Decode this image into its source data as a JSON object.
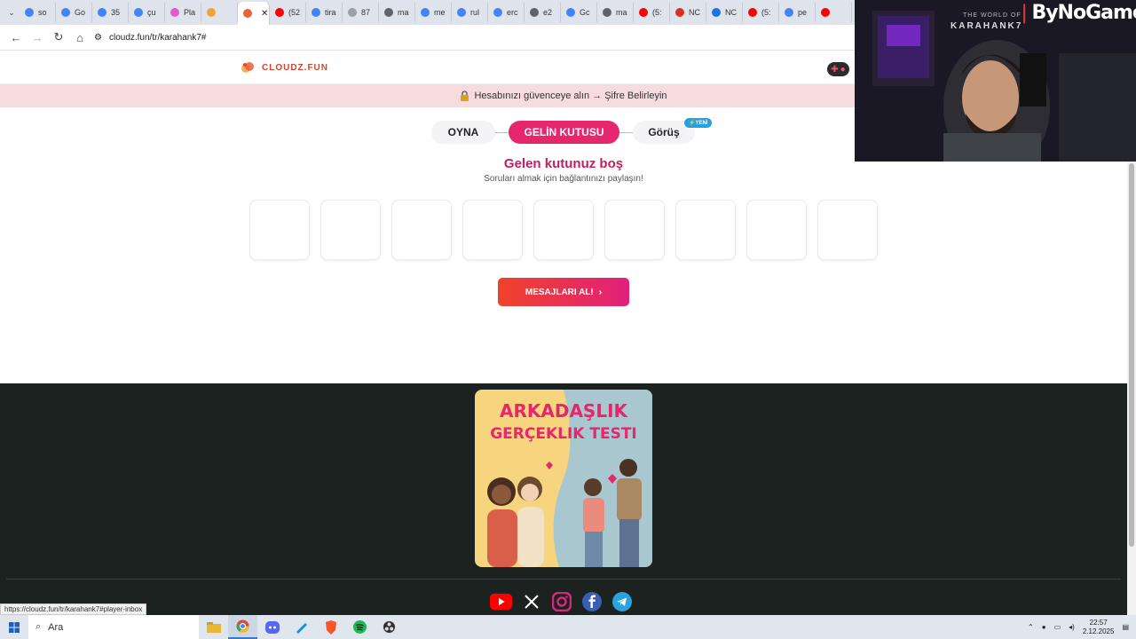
{
  "browser": {
    "tabs": [
      {
        "label": "so",
        "favicon_color": "#4285f4"
      },
      {
        "label": "Go",
        "favicon_color": "#4285f4"
      },
      {
        "label": "35",
        "favicon_color": "#4285f4"
      },
      {
        "label": "çu",
        "favicon_color": "#4285f4"
      },
      {
        "label": "Pla",
        "favicon_color": "#e05cc8"
      },
      {
        "label": "",
        "favicon_color": "#f2a23a"
      },
      {
        "label": "",
        "favicon_color": "#e8623a",
        "active": true
      },
      {
        "label": "(52",
        "favicon_color": "#ff0000"
      },
      {
        "label": "tira",
        "favicon_color": "#4285f4"
      },
      {
        "label": "87",
        "favicon_color": "#9aa0a6"
      },
      {
        "label": "ma",
        "favicon_color": "#5f6368"
      },
      {
        "label": "me",
        "favicon_color": "#4285f4"
      },
      {
        "label": "rul",
        "favicon_color": "#4285f4"
      },
      {
        "label": "erc",
        "favicon_color": "#4285f4"
      },
      {
        "label": "e2",
        "favicon_color": "#5f6368"
      },
      {
        "label": "Gc",
        "favicon_color": "#4285f4"
      },
      {
        "label": "ma",
        "favicon_color": "#5f6368"
      },
      {
        "label": "(5:",
        "favicon_color": "#ff0000"
      },
      {
        "label": "NC",
        "favicon_color": "#d93025"
      },
      {
        "label": "NC",
        "favicon_color": "#1a73e8"
      },
      {
        "label": "(5:",
        "favicon_color": "#ff0000"
      },
      {
        "label": "pe",
        "favicon_color": "#4285f4"
      },
      {
        "label": "",
        "favicon_color": "#ff0000"
      }
    ],
    "url": "cloudz.fun/tr/karahank7#",
    "status_url": "https://cloudz.fun/tr/karahank7#player-inbox"
  },
  "site": {
    "logo_text": "CLOUDZ.FUN",
    "banner_icon": "lock-icon",
    "banner_text": "Hesabınızı güvenceye alın → Şifre Belirleyin",
    "tabs": {
      "play": "OYNA",
      "inbox": "GELİN KUTUSU",
      "opinion": "Görüş",
      "new_badge": "⚡YENİ"
    },
    "inbox": {
      "title": "Gelen kutunuz boş",
      "subtitle": "Soruları almak için bağlantınızı paylaşın!",
      "placeholder_cards": 9
    },
    "get_messages_label": "MESAJLARI AL!",
    "footer": {
      "promo_line1": "ARKADAŞLIK",
      "promo_line2": "GERÇEKLIK TESTI",
      "socials": [
        "youtube-icon",
        "x-icon",
        "instagram-icon",
        "facebook-icon",
        "telegram-icon"
      ]
    }
  },
  "webcam": {
    "title_small": "THE WORLD OF",
    "title_big": "KARAHANK7",
    "brand": "ByNoGame"
  },
  "taskbar": {
    "search_placeholder": "Ara",
    "time": "22:57",
    "date": "2.12.2025"
  },
  "colors": {
    "accent": "#e6266d",
    "banner_bg": "#f7dcdf",
    "footer_bg": "#1c2220"
  }
}
